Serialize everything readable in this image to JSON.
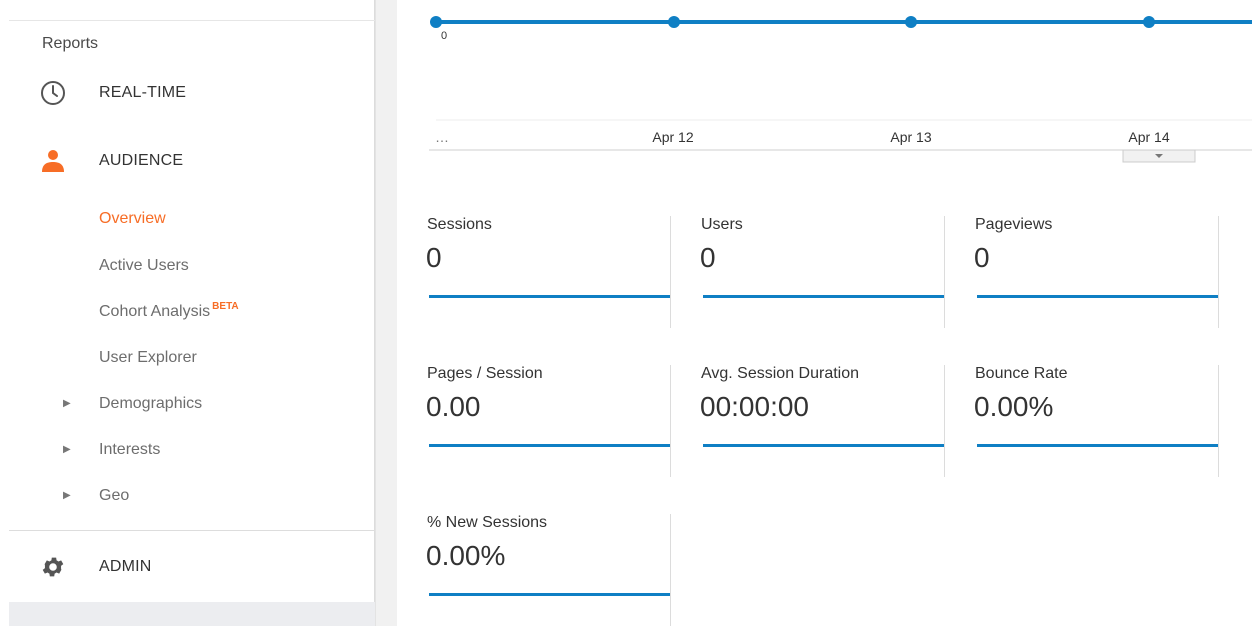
{
  "sidebar": {
    "section_title": "Reports",
    "realtime_label": "REAL-TIME",
    "audience_label": "AUDIENCE",
    "admin_label": "ADMIN",
    "items": [
      {
        "label": "Overview",
        "active": true
      },
      {
        "label": "Active Users"
      },
      {
        "label": "Cohort Analysis",
        "badge": "BETA"
      },
      {
        "label": "User Explorer"
      },
      {
        "label": "Demographics",
        "expandable": true
      },
      {
        "label": "Interests",
        "expandable": true
      },
      {
        "label": "Geo",
        "expandable": true
      }
    ],
    "icons": {
      "realtime": "clock-icon",
      "audience": "person-icon",
      "admin": "gear-icon"
    },
    "colors": {
      "active": "#f76d26",
      "audience_icon": "#f76d26"
    }
  },
  "chart_data": {
    "type": "line",
    "x": [
      "…",
      "Apr 12",
      "Apr 13",
      "Apr 14"
    ],
    "series": [
      {
        "values": [
          0,
          0,
          0,
          0
        ]
      }
    ],
    "y_tick_labels": [
      "0"
    ],
    "color": "#0f7fc4"
  },
  "metrics": {
    "items": [
      {
        "label": "Sessions",
        "value": "0"
      },
      {
        "label": "Users",
        "value": "0"
      },
      {
        "label": "Pageviews",
        "value": "0"
      },
      {
        "label": "Pages / Session",
        "value": "0.00"
      },
      {
        "label": "Avg. Session Duration",
        "value": "00:00:00"
      },
      {
        "label": "Bounce Rate",
        "value": "0.00%"
      },
      {
        "label": "% New Sessions",
        "value": "0.00%"
      }
    ],
    "spark_color": "#0f7fc4"
  }
}
